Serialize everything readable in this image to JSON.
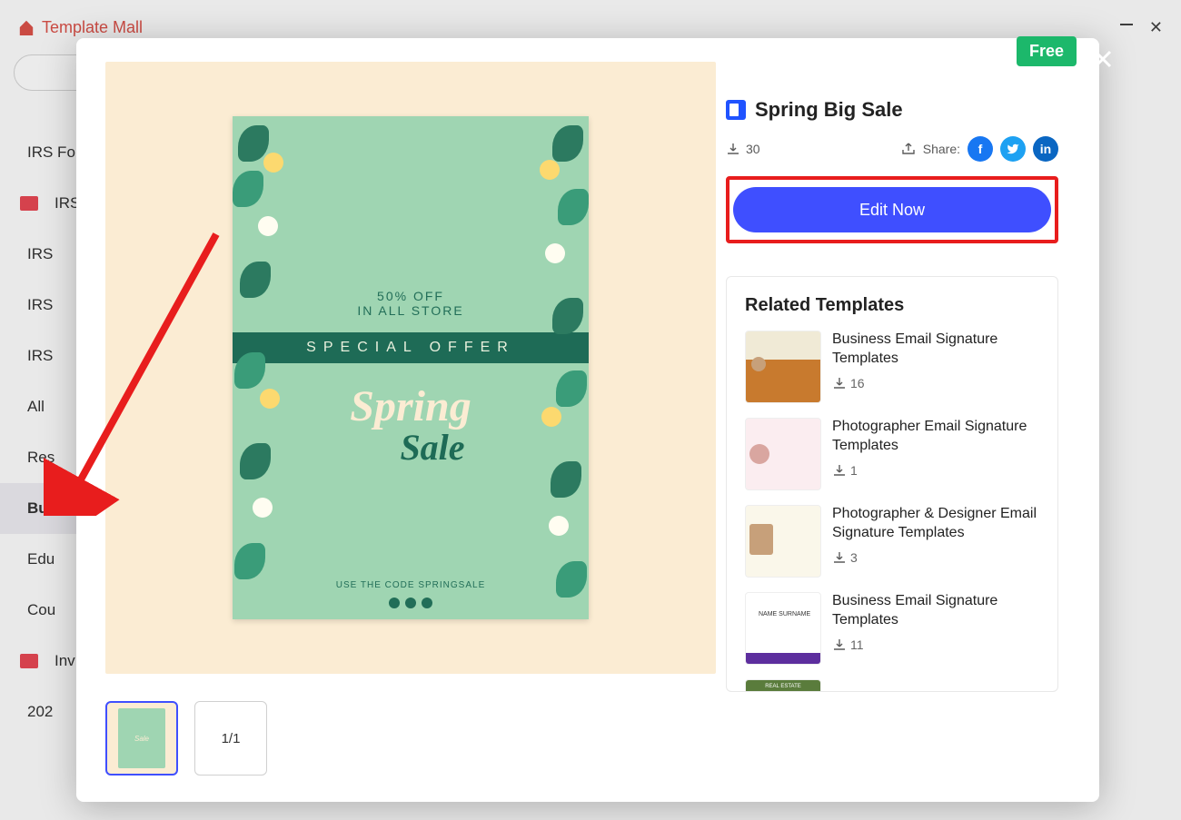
{
  "header": {
    "title": "Template Mall"
  },
  "sidebar": {
    "items": [
      {
        "label": "IRS Fo"
      },
      {
        "label": "IRS",
        "new": true
      },
      {
        "label": "IRS"
      },
      {
        "label": "IRS"
      },
      {
        "label": "IRS"
      },
      {
        "label": "All"
      },
      {
        "label": "Res"
      },
      {
        "label": "Bus",
        "selected": true
      },
      {
        "label": "Edu"
      },
      {
        "label": "Cou"
      },
      {
        "label": "Inv",
        "new": true
      },
      {
        "label": "202"
      }
    ]
  },
  "modal": {
    "badge": "Free",
    "title": "Spring Big Sale",
    "downloads": "30",
    "share_label": "Share:",
    "edit_label": "Edit Now",
    "page_indicator": "1/1",
    "poster": {
      "offer_line1": "50% OFF",
      "offer_line2": "IN ALL STORE",
      "band": "SPECIAL OFFER",
      "title1": "Spring",
      "title2": "Sale",
      "code_text": "USE THE CODE SPRINGSALE"
    },
    "related": {
      "heading": "Related Templates",
      "items": [
        {
          "name": "Business Email Signature Templates",
          "downloads": "16"
        },
        {
          "name": "Photographer Email Signature Templates",
          "downloads": "1"
        },
        {
          "name": "Photographer & Designer Email Signature Templates",
          "downloads": "3"
        },
        {
          "name": "Business Email Signature Templates",
          "downloads": "11"
        },
        {
          "name": "REAL ESTATE",
          "downloads": ""
        }
      ]
    }
  }
}
